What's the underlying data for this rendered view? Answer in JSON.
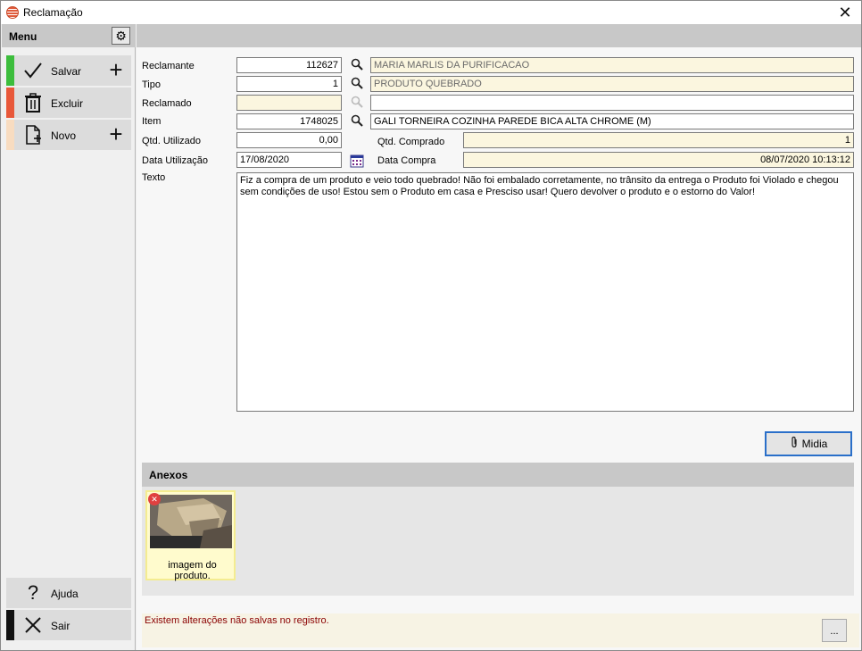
{
  "window": {
    "title": "Reclamação",
    "close_icon": "close-icon"
  },
  "sidebar": {
    "title": "Menu",
    "settings_icon": "gear-icon",
    "buttons": [
      {
        "label": "Salvar",
        "accent": "#3cbd3c",
        "icon": "check-icon",
        "has_plus": true
      },
      {
        "label": "Excluir",
        "accent": "#e8583a",
        "icon": "trash-icon",
        "has_plus": false
      },
      {
        "label": "Novo",
        "accent": "#f8dcc0",
        "icon": "new-document-icon",
        "has_plus": true
      }
    ],
    "bottom_buttons": [
      {
        "label": "Ajuda",
        "accent": "#dcdcdc",
        "icon": "question-icon"
      },
      {
        "label": "Sair",
        "accent": "#111111",
        "icon": "close-icon"
      }
    ]
  },
  "form": {
    "reclamante": {
      "label": "Reclamante",
      "code": "112627",
      "name": "MARIA MARLIS DA PURIFICACAO"
    },
    "tipo": {
      "label": "Tipo",
      "code": "1",
      "name": "PRODUTO QUEBRADO"
    },
    "reclamado": {
      "label": "Reclamado",
      "code": "",
      "name": ""
    },
    "item": {
      "label": "Item",
      "code": "1748025",
      "name": "GALI TORNEIRA COZINHA PAREDE BICA ALTA CHROME (M)"
    },
    "qtd_utilizado": {
      "label": "Qtd. Utilizado",
      "value": "0,00"
    },
    "qtd_comprado": {
      "label": "Qtd. Comprado",
      "value": "1"
    },
    "data_utilizacao": {
      "label": "Data Utilização",
      "value": "17/08/2020"
    },
    "data_compra": {
      "label": "Data Compra",
      "value": "08/07/2020 10:13:12"
    },
    "texto": {
      "label": "Texto",
      "value": "Fiz a compra de um produto e veio todo quebrado! Não foi embalado corretamente, no trânsito da entrega o Produto foi Violado e chegou sem condições de uso! Estou sem o Produto em casa e Presciso usar! Quero devolver o produto e o estorno do Valor!"
    }
  },
  "midia_button": {
    "label": "Midia",
    "icon": "paperclip-icon"
  },
  "anexos": {
    "title": "Anexos",
    "items": [
      {
        "caption": "imagem do produto.",
        "delete_icon": "delete-icon"
      }
    ]
  },
  "status": {
    "message": "Existem alterações não salvas no registro.",
    "more_label": "..."
  },
  "colors": {
    "header_gray": "#c8c8c8",
    "readonly_yellow": "#fbf6df",
    "status_text": "#8a0000",
    "focus_blue": "#2a6fc9"
  }
}
